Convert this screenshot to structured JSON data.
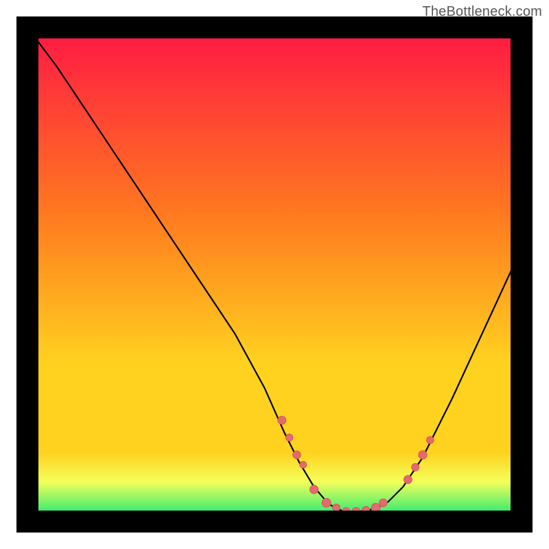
{
  "watermark": "TheBottleneck.com",
  "colors": {
    "frame": "#000000",
    "curve": "#000000",
    "marker_fill": "#e36a6f",
    "marker_stroke": "#d44c53",
    "grad_top": "#ff1744",
    "grad_mid1": "#ff7a1f",
    "grad_mid2": "#ffd21f",
    "grad_band": "#f3ff5a",
    "grad_bottom": "#00e676"
  },
  "chart_data": {
    "type": "line",
    "title": "",
    "xlabel": "",
    "ylabel": "",
    "xlim": [
      0,
      100
    ],
    "ylim": [
      0,
      100
    ],
    "grid": false,
    "legend": false,
    "series": [
      {
        "name": "bottleneck-curve",
        "x": [
          0,
          6,
          12,
          18,
          24,
          30,
          36,
          42,
          48,
          52,
          55,
          58,
          61,
          64,
          67,
          70,
          73,
          76,
          80,
          86,
          92,
          98,
          100
        ],
        "y": [
          100,
          92,
          83,
          74,
          65,
          56,
          47,
          38,
          27,
          18,
          12,
          7,
          3.5,
          2,
          2,
          2.5,
          4,
          7,
          13,
          25,
          38,
          51,
          56
        ]
      }
    ],
    "markers": {
      "name": "scatter-points",
      "x": [
        51.5,
        53.0,
        54.5,
        55.8,
        58.0,
        60.5,
        62.5,
        64.5,
        66.5,
        68.5,
        70.5,
        72.0,
        77.0,
        78.5,
        80.0,
        81.5
      ],
      "y": [
        20.5,
        17.0,
        13.5,
        11.5,
        6.5,
        3.8,
        2.8,
        2.0,
        2.0,
        2.3,
        2.8,
        3.8,
        8.5,
        11.0,
        13.5,
        16.5
      ],
      "r": [
        6.0,
        5.2,
        5.8,
        5.0,
        6.2,
        6.5,
        5.5,
        6.0,
        6.2,
        5.5,
        6.5,
        5.8,
        6.0,
        5.5,
        6.2,
        5.3
      ]
    }
  }
}
